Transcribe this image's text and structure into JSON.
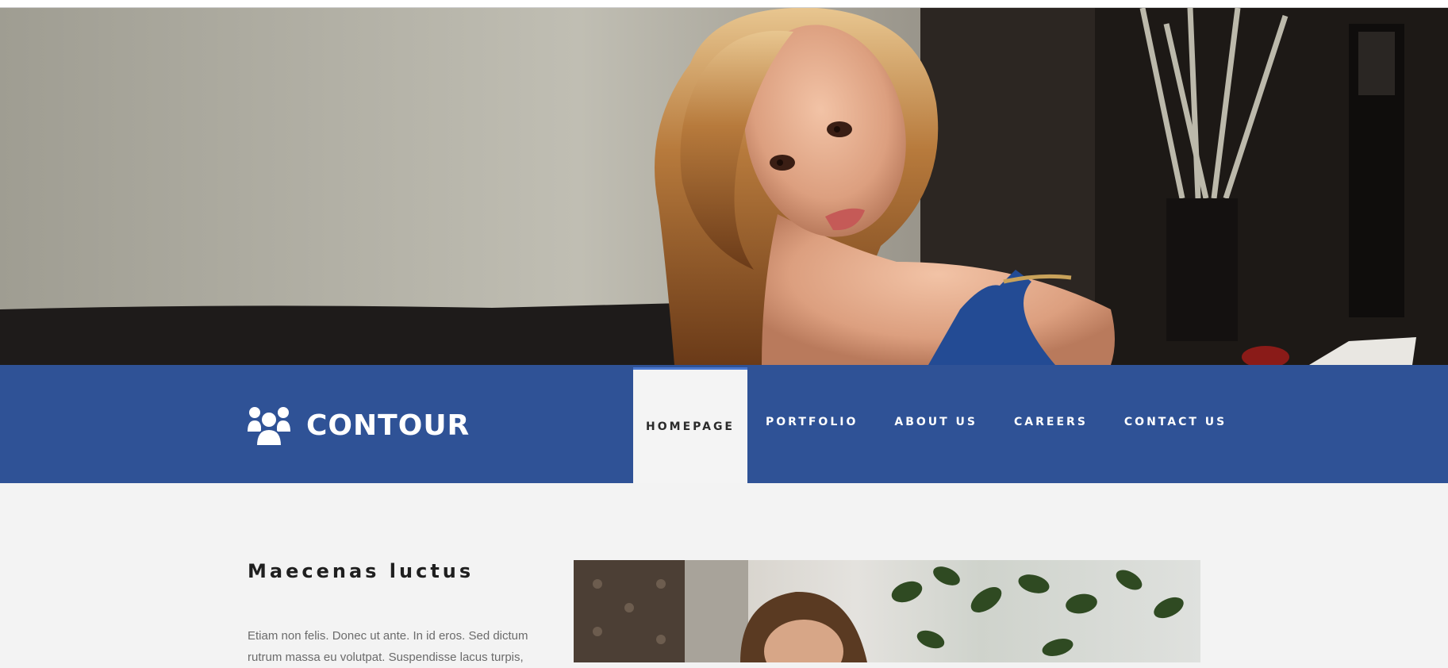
{
  "brand": {
    "name": "CONTOUR",
    "icon": "users-group-icon"
  },
  "nav": {
    "items": [
      {
        "label": "HOMEPAGE",
        "active": true
      },
      {
        "label": "PORTFOLIO",
        "active": false
      },
      {
        "label": "ABOUT US",
        "active": false
      },
      {
        "label": "CAREERS",
        "active": false
      },
      {
        "label": "CONTACT US",
        "active": false
      }
    ]
  },
  "content": {
    "title": "Maecenas luctus",
    "text": "Etiam non felis. Donec ut ante. In id eros. Sed dictum rutrum massa eu volutpat. Suspendisse lacus turpis,"
  },
  "colors": {
    "nav_background": "#2f5296",
    "active_tab_background": "#f4f4f4",
    "active_tab_accent": "#4b79d0",
    "page_background": "#f3f3f3"
  }
}
